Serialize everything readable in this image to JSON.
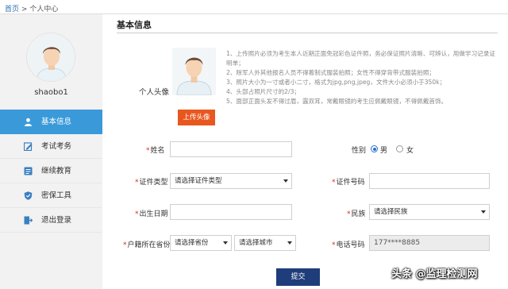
{
  "breadcrumb": {
    "home": "首页",
    "sep": ">",
    "current": "个人中心"
  },
  "sidebar": {
    "username": "shaobo1",
    "items": [
      {
        "label": "基本信息",
        "icon": "user-icon",
        "active": true
      },
      {
        "label": "考试考务",
        "icon": "edit-icon",
        "active": false
      },
      {
        "label": "继续教育",
        "icon": "list-icon",
        "active": false
      },
      {
        "label": "密保工具",
        "icon": "shield-icon",
        "active": false
      },
      {
        "label": "退出登录",
        "icon": "logout-icon",
        "active": false
      }
    ]
  },
  "main": {
    "title": "基本信息",
    "avatar_label": "个人头像",
    "upload_label": "上传头像",
    "notes": [
      "1、上传照片必须为考生本人近期正面免冠彩色证件照，务必保证照片清晰、可辨认，用做学习记录证明单；",
      "2、除军人外其他报名人员不得着制式服装拍照；女性不得穿背带式服装拍照；",
      "3、照片大小为一寸或者小二寸，格式为jpg,png,jpeg，文件大小必须小于350k；",
      "4、头部占照片尺寸的2/3；",
      "5、面部正面头发不得过眉，露双耳，常戴眼镜的考生应佩戴眼镜，不得佩戴首饰。"
    ]
  },
  "form": {
    "name_label": "姓名",
    "name_value": "",
    "gender_label": "性别",
    "male": "男",
    "female": "女",
    "gender_selected": "男",
    "idtype_label": "证件类型",
    "idtype_value": "请选择证件类型",
    "idno_label": "证件号码",
    "idno_value": "",
    "birth_label": "出生日期",
    "birth_value": "",
    "ethnic_label": "民族",
    "ethnic_value": "请选择民族",
    "hukou_label": "户籍所在省份",
    "province_value": "请选择省份",
    "city_value": "请选择城市",
    "phone_label": "电话号码",
    "phone_value": "177****8885",
    "submit_label": "提交"
  },
  "watermark": "头条 @监理检测网",
  "colors": {
    "active": "#3a9ad9",
    "upload": "#e8571f",
    "submit": "#1e3d7a",
    "required": "#dd2222"
  }
}
